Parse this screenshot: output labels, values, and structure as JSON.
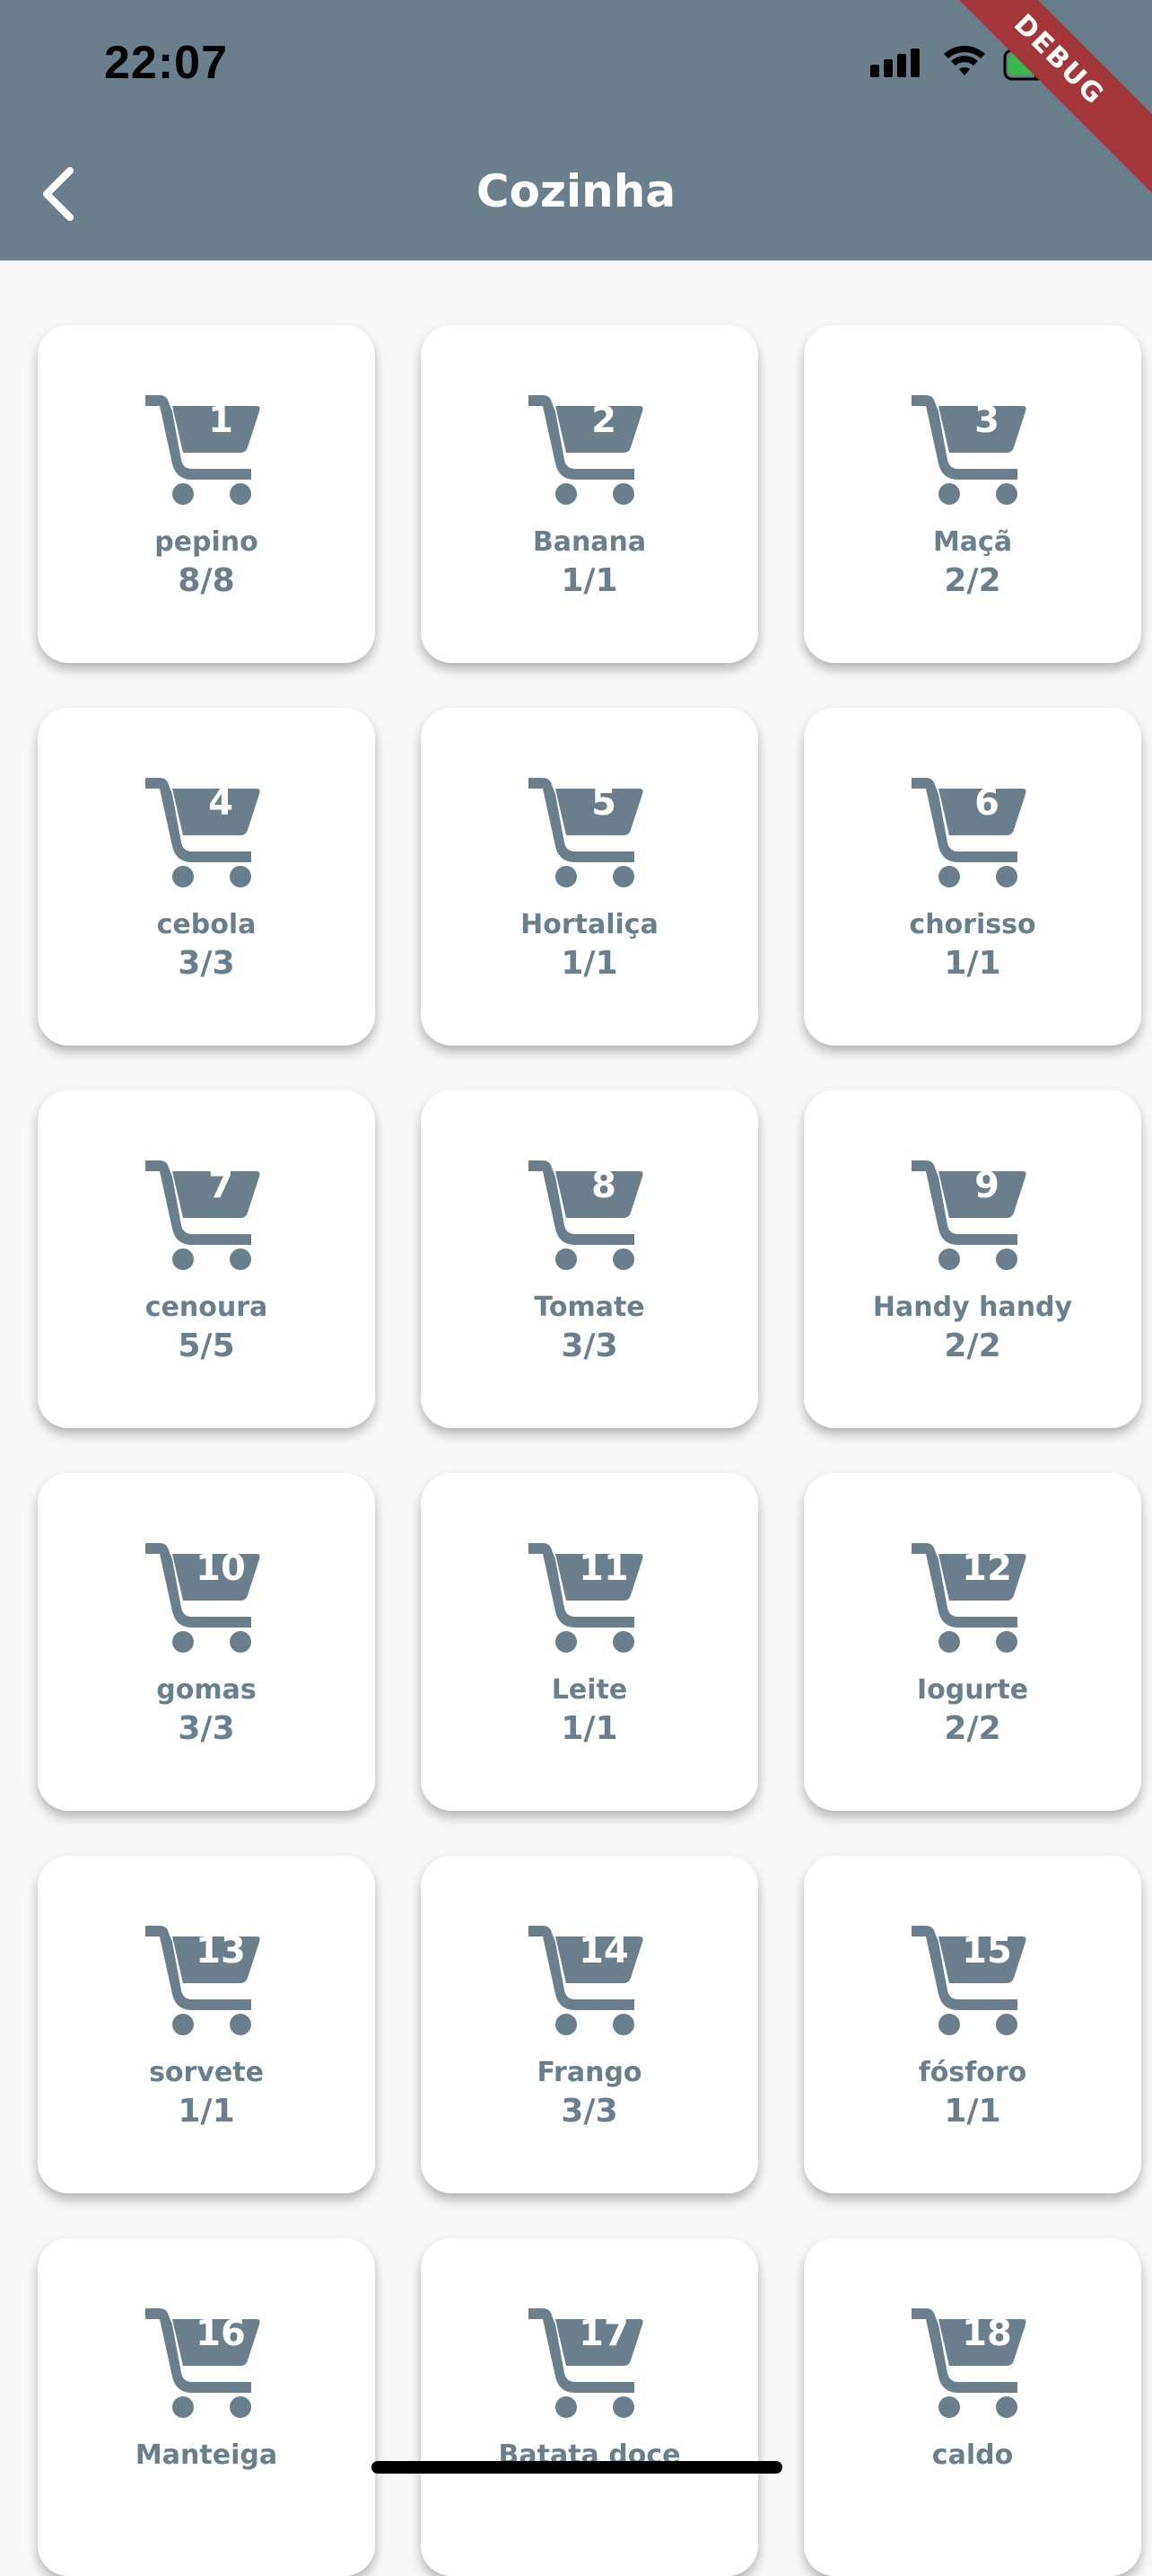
{
  "status_bar": {
    "time": "22:07"
  },
  "debug_banner": "DEBUG",
  "header": {
    "title": "Cozinha",
    "back_icon": "chevron-left-icon"
  },
  "colors": {
    "appbar": "#6a7e8b",
    "accent": "#6a7e8b",
    "background": "#f8f8f8",
    "card": "#ffffff"
  },
  "items": [
    {
      "number": "1",
      "name": "pepino",
      "count": "8/8"
    },
    {
      "number": "2",
      "name": "Banana",
      "count": "1/1"
    },
    {
      "number": "3",
      "name": "Maçã",
      "count": "2/2"
    },
    {
      "number": "4",
      "name": "cebola",
      "count": "3/3"
    },
    {
      "number": "5",
      "name": "Hortaliça",
      "count": "1/1"
    },
    {
      "number": "6",
      "name": "chorisso",
      "count": "1/1"
    },
    {
      "number": "7",
      "name": "cenoura",
      "count": "5/5"
    },
    {
      "number": "8",
      "name": "Tomate",
      "count": "3/3"
    },
    {
      "number": "9",
      "name": "Handy handy",
      "count": "2/2"
    },
    {
      "number": "10",
      "name": "gomas",
      "count": "3/3"
    },
    {
      "number": "11",
      "name": "Leite",
      "count": "1/1"
    },
    {
      "number": "12",
      "name": "Iogurte",
      "count": "2/2"
    },
    {
      "number": "13",
      "name": "sorvete",
      "count": "1/1"
    },
    {
      "number": "14",
      "name": "Frango",
      "count": "3/3"
    },
    {
      "number": "15",
      "name": "fósforo",
      "count": "1/1"
    },
    {
      "number": "16",
      "name": "Manteiga",
      "count": ""
    },
    {
      "number": "17",
      "name": "Batata doce",
      "count": ""
    },
    {
      "number": "18",
      "name": "caldo",
      "count": ""
    }
  ]
}
